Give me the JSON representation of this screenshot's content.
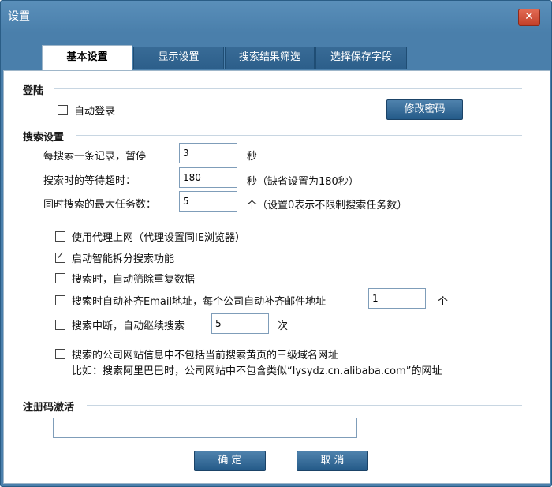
{
  "window": {
    "title": "设置",
    "close_symbol": "✕"
  },
  "tabs": [
    {
      "label": "基本设置",
      "active": true
    },
    {
      "label": "显示设置",
      "active": false
    },
    {
      "label": "搜索结果筛选",
      "active": false
    },
    {
      "label": "选择保存字段",
      "active": false
    }
  ],
  "login": {
    "section_title": "登陆",
    "auto_login_label": "自动登录",
    "auto_login_checked": false,
    "change_password_button": "修改密码"
  },
  "search": {
    "section_title": "搜索设置",
    "pause_label": "每搜索一条记录，暂停",
    "pause_value": "3",
    "pause_unit": "秒",
    "timeout_label": "搜索时的等待超时：",
    "timeout_value": "180",
    "timeout_unit": "秒（缺省设置为180秒）",
    "max_tasks_label": "同时搜索的最大任务数：",
    "max_tasks_value": "5",
    "max_tasks_unit": "个（设置0表示不限制搜索任务数）"
  },
  "options": [
    {
      "label": "使用代理上网（代理设置同IE浏览器）",
      "checked": false
    },
    {
      "label": "启动智能拆分搜索功能",
      "checked": true
    },
    {
      "label": "搜索时，自动筛除重复数据",
      "checked": false
    },
    {
      "label": "搜索时自动补齐Email地址，每个公司自动补齐邮件地址",
      "checked": false,
      "value": "1",
      "unit": "个"
    },
    {
      "label": "搜索中断，自动继续搜索",
      "checked": false,
      "value": "5",
      "unit": "次"
    },
    {
      "label": "搜索的公司网站信息中不包括当前搜索黄页的三级域名网址",
      "checked": false,
      "note": "比如：搜索阿里巴巴时，公司网站中不包含类似“lysydz.cn.alibaba.com”的网址"
    }
  ],
  "registration": {
    "section_title": "注册码激活",
    "code_value": ""
  },
  "footer": {
    "ok_button": "确 定",
    "cancel_button": "取 消"
  }
}
